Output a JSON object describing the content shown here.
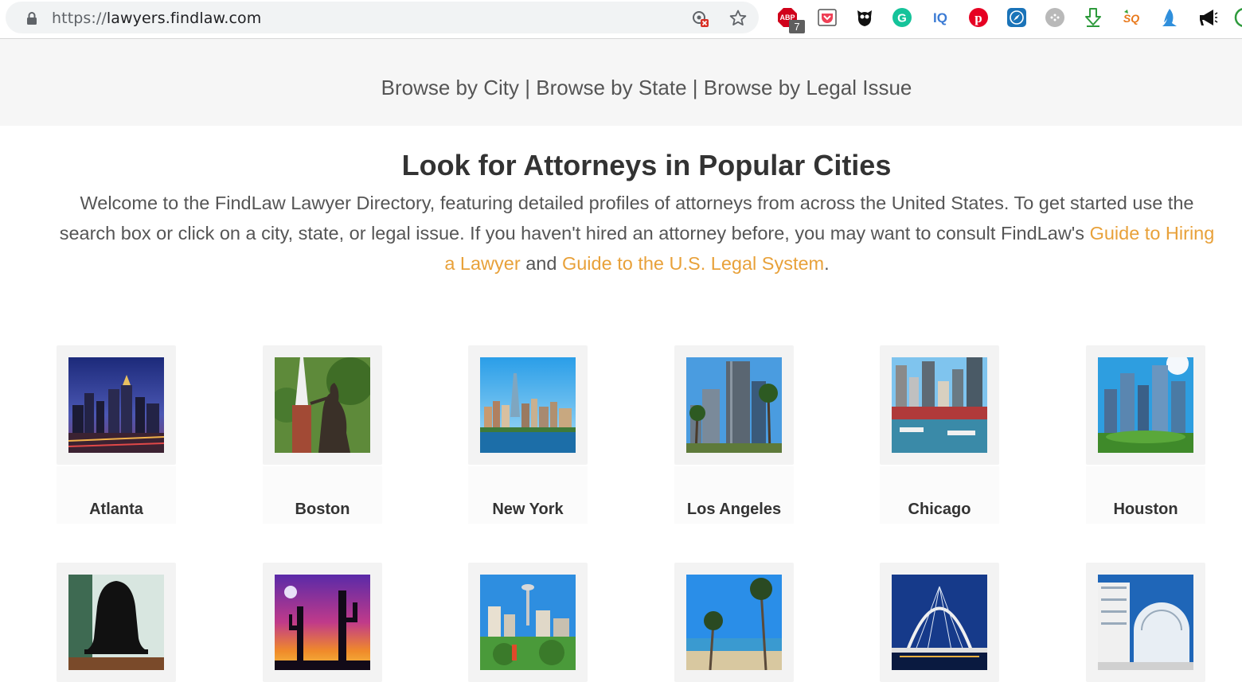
{
  "browser": {
    "url_protocol": "https://",
    "url_host": "lawyers.findlaw.com",
    "extension_badge": "7",
    "extensions": [
      "adblock-icon",
      "pocket-icon",
      "owl-icon",
      "grammarly-icon",
      "iq-icon",
      "pinterest-icon",
      "compass-icon",
      "dots-icon",
      "download-icon",
      "sq-icon",
      "flame-icon",
      "megaphone-icon"
    ]
  },
  "nav": {
    "city": "Browse by City",
    "state": "Browse by State",
    "issue": "Browse by Legal Issue",
    "separator": "|"
  },
  "headline": "Look for Attorneys in Popular Cities",
  "intro": {
    "text1": "Welcome to the FindLaw Lawyer Directory, featuring detailed profiles of attorneys from across the United States. To get started use the search box or click on a city, state, or legal issue. If you haven't hired an attorney before, you may want to consult FindLaw's ",
    "link1": "Guide to Hiring a Lawyer",
    "text2": " and ",
    "link2": "Guide to the U.S. Legal System",
    "text3": "."
  },
  "cities": [
    {
      "name": "Atlanta"
    },
    {
      "name": "Boston"
    },
    {
      "name": "New York"
    },
    {
      "name": "Los Angeles"
    },
    {
      "name": "Chicago"
    },
    {
      "name": "Houston"
    }
  ],
  "colors": {
    "link_orange": "#e8a13a",
    "text_gray": "#555555",
    "heading": "#333333",
    "nav_band": "#f6f6f6"
  }
}
